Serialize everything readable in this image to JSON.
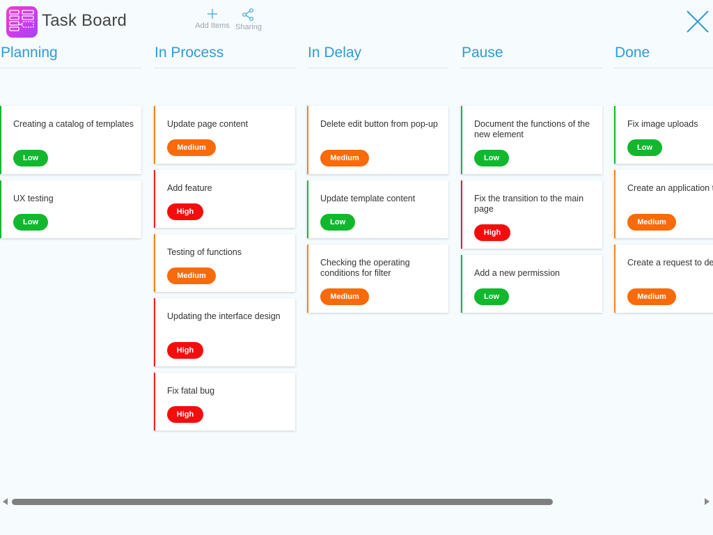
{
  "header": {
    "title": "Task Board",
    "add_items_label": "Add Items",
    "sharing_label": "Sharing",
    "accent_color": "#2d9bd6",
    "logo_icon": "board-layout-icon",
    "close_icon": "close-icon"
  },
  "columns": [
    {
      "title": "Planning",
      "cards": [
        {
          "title": "Creating a catalog of templates",
          "priority": "Low"
        },
        {
          "title": "UX testing",
          "priority": "Low"
        }
      ]
    },
    {
      "title": "In Process",
      "cards": [
        {
          "title": "Update page content",
          "priority": "Medium"
        },
        {
          "title": "Add feature",
          "priority": "High"
        },
        {
          "title": "Testing of functions",
          "priority": "Medium"
        },
        {
          "title": "Updating the interface design",
          "priority": "High"
        },
        {
          "title": "Fix fatal bug",
          "priority": "High"
        }
      ]
    },
    {
      "title": "In Delay",
      "cards": [
        {
          "title": "Delete edit button from pop-up",
          "priority": "Medium"
        },
        {
          "title": "Update template content",
          "priority": "Low"
        },
        {
          "title": "Checking the operating conditions for filter",
          "priority": "Medium"
        }
      ]
    },
    {
      "title": "Pause",
      "cards": [
        {
          "title": "Document the functions of the new element",
          "priority": "Low"
        },
        {
          "title": "Fix the transition to the main page",
          "priority": "High"
        },
        {
          "title": "Add a new permission",
          "priority": "Low"
        }
      ]
    },
    {
      "title": "Done",
      "cards": [
        {
          "title": "Fix image uploads",
          "priority": "Low"
        },
        {
          "title": "Create an application template",
          "priority": "Medium"
        },
        {
          "title": "Create a request to delete file",
          "priority": "Medium"
        }
      ]
    }
  ],
  "priority_colors": {
    "Low": "#11b82e",
    "Medium": "#f96a0b",
    "High": "#f50d0d"
  }
}
